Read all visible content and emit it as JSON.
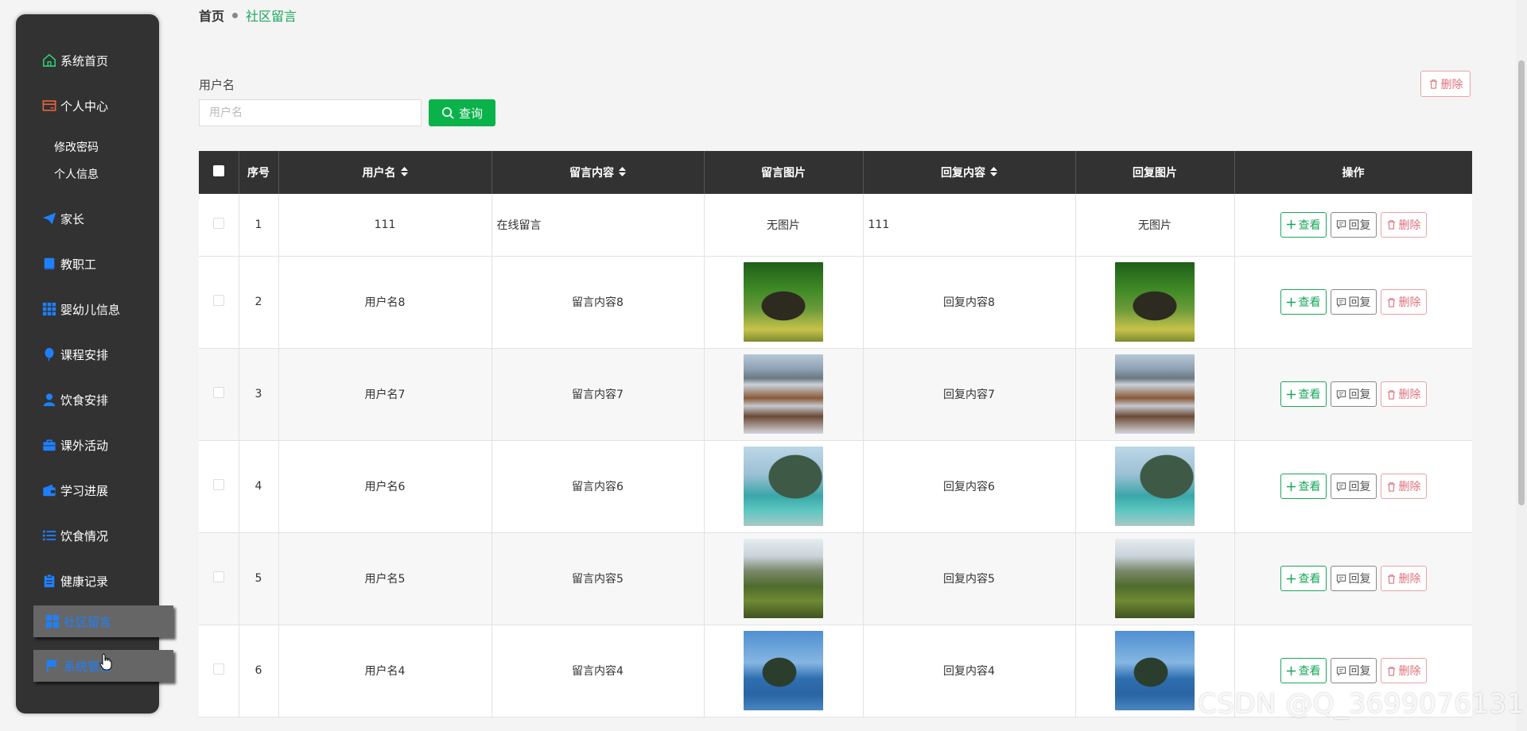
{
  "sidebar": {
    "items": [
      {
        "label": "系统首页",
        "icon": "home-icon",
        "color": "#2ecc71"
      },
      {
        "label": "个人中心",
        "icon": "card-icon",
        "color": "#e8643c"
      },
      {
        "label": "家长",
        "icon": "paper-plane-icon",
        "color": "#1e80ff"
      },
      {
        "label": "教职工",
        "icon": "book-icon",
        "color": "#1e80ff"
      },
      {
        "label": "婴幼儿信息",
        "icon": "grid-icon",
        "color": "#1e80ff"
      },
      {
        "label": "课程安排",
        "icon": "balloon-icon",
        "color": "#1e80ff"
      },
      {
        "label": "饮食安排",
        "icon": "user-icon",
        "color": "#1e80ff"
      },
      {
        "label": "课外活动",
        "icon": "briefcase-icon",
        "color": "#1e80ff"
      },
      {
        "label": "学习进展",
        "icon": "wallet-icon",
        "color": "#1e80ff"
      },
      {
        "label": "饮食情况",
        "icon": "list-icon",
        "color": "#1e80ff"
      },
      {
        "label": "健康记录",
        "icon": "clipboard-icon",
        "color": "#1e80ff"
      },
      {
        "label": "社区留言",
        "icon": "dashboard-icon",
        "color": "#1e80ff"
      },
      {
        "label": "系统管理",
        "icon": "flag-icon",
        "color": "#1e80ff"
      }
    ],
    "sub_items": [
      "修改密码",
      "个人信息"
    ]
  },
  "breadcrumb": {
    "home": "首页",
    "current": "社区留言"
  },
  "search": {
    "label": "用户名",
    "placeholder": "用户名",
    "button": "查询"
  },
  "toolbar": {
    "delete_label": "删除"
  },
  "table": {
    "headers": [
      "序号",
      "用户名",
      "留言内容",
      "留言图片",
      "回复内容",
      "回复图片",
      "操作"
    ],
    "ops": {
      "view": "查看",
      "reply": "回复",
      "delete": "删除"
    },
    "rows": [
      {
        "index": "1",
        "username": "111",
        "content": "在线留言",
        "image": "无图片",
        "reply": "111",
        "reply_image": "无图片"
      },
      {
        "index": "2",
        "username": "用户名8",
        "content": "留言内容8",
        "image": "bridge",
        "reply": "回复内容8",
        "reply_image": "bridge"
      },
      {
        "index": "3",
        "username": "用户名7",
        "content": "留言内容7",
        "image": "village",
        "reply": "回复内容7",
        "reply_image": "village"
      },
      {
        "index": "4",
        "username": "用户名6",
        "content": "留言内容6",
        "image": "lake",
        "reply": "回复内容6",
        "reply_image": "lake"
      },
      {
        "index": "5",
        "username": "用户名5",
        "content": "留言内容5",
        "image": "mountains",
        "reply": "回复内容5",
        "reply_image": "mountains"
      },
      {
        "index": "6",
        "username": "用户名4",
        "content": "留言内容4",
        "image": "bay",
        "reply": "回复内容4",
        "reply_image": "bay"
      }
    ]
  },
  "watermark": "CSDN @Q_3699076131",
  "colors": {
    "accent": "#0ab34a",
    "sidebar_bg": "#323232",
    "danger": "#e0707a",
    "link": "#1aa65b"
  }
}
